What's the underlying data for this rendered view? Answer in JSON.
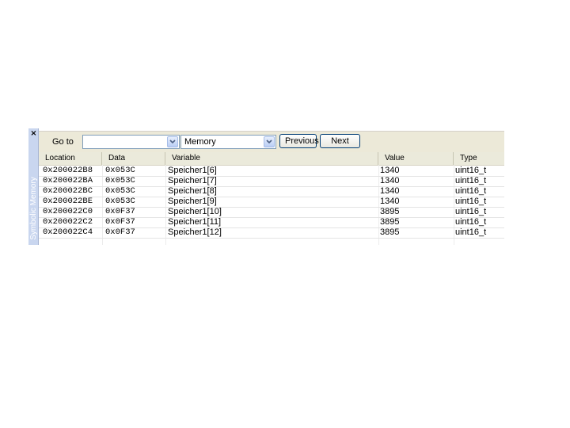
{
  "panel": {
    "side_title": "Symbolic Memory",
    "close_glyph": "×"
  },
  "toolbar": {
    "goto_label": "Go to",
    "goto_value": "",
    "memory_value": "Memory",
    "previous_label": "Previous",
    "next_label": "Next"
  },
  "table": {
    "headers": {
      "location": "Location",
      "data": "Data",
      "variable": "Variable",
      "value": "Value",
      "type": "Type"
    },
    "rows": [
      {
        "location": "0x200022B8",
        "data": "0x053C",
        "variable": "Speicher1[6]",
        "value": "1340",
        "type": "uint16_t"
      },
      {
        "location": "0x200022BA",
        "data": "0x053C",
        "variable": "Speicher1[7]",
        "value": "1340",
        "type": "uint16_t"
      },
      {
        "location": "0x200022BC",
        "data": "0x053C",
        "variable": "Speicher1[8]",
        "value": "1340",
        "type": "uint16_t"
      },
      {
        "location": "0x200022BE",
        "data": "0x053C",
        "variable": "Speicher1[9]",
        "value": "1340",
        "type": "uint16_t"
      },
      {
        "location": "0x200022C0",
        "data": "0x0F37",
        "variable": "Speicher1[10]",
        "value": "3895",
        "type": "uint16_t"
      },
      {
        "location": "0x200022C2",
        "data": "0x0F37",
        "variable": "Speicher1[11]",
        "value": "3895",
        "type": "uint16_t"
      },
      {
        "location": "0x200022C4",
        "data": "0x0F37",
        "variable": "Speicher1[12]",
        "value": "3895",
        "type": "uint16_t"
      }
    ]
  }
}
